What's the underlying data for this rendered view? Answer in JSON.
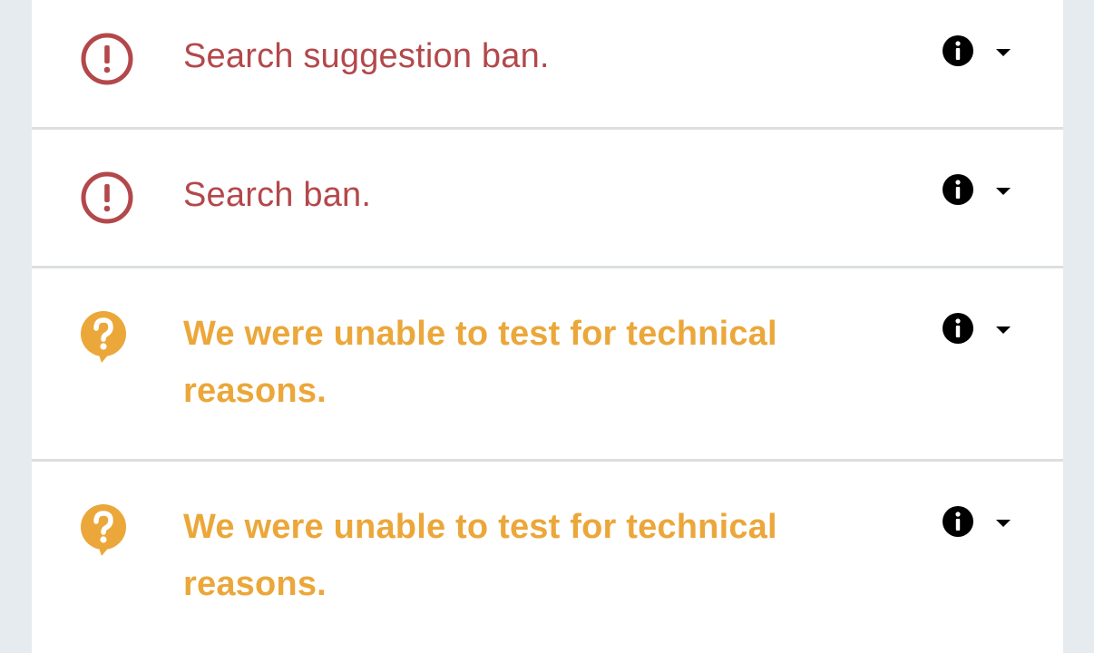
{
  "results": [
    {
      "status": "error",
      "icon": "alert-circle-icon",
      "message": "Search suggestion ban."
    },
    {
      "status": "error",
      "icon": "alert-circle-icon",
      "message": "Search ban."
    },
    {
      "status": "unknown",
      "icon": "question-bubble-icon",
      "message": "We were unable to test for technical reasons."
    },
    {
      "status": "unknown",
      "icon": "question-bubble-icon",
      "message": "We were unable to test for technical reasons."
    }
  ],
  "colors": {
    "error": "#b3484b",
    "warning": "#eba73a",
    "background": "#e6ebef",
    "card": "#ffffff",
    "divider": "#dcdfe2"
  }
}
